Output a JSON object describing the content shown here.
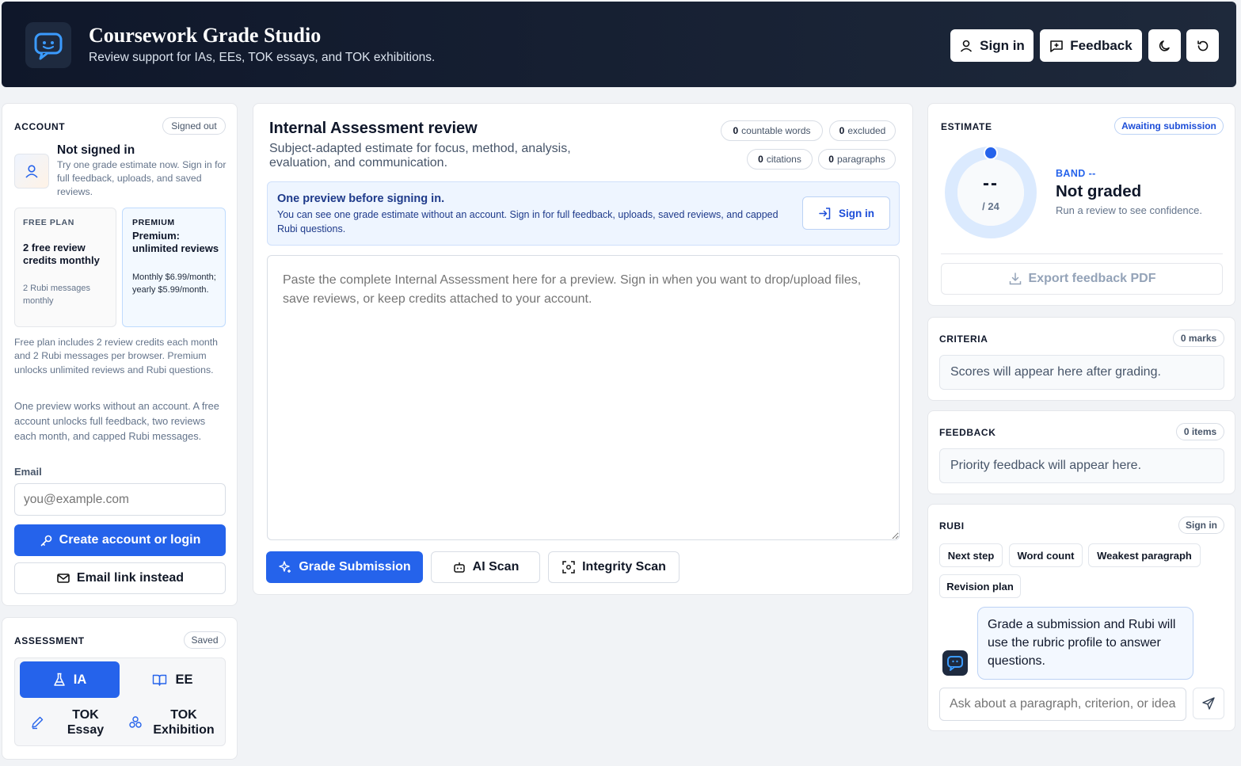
{
  "header": {
    "title": "Coursework Grade Studio",
    "subtitle": "Review support for IAs, EEs, TOK essays, and TOK exhibitions.",
    "sign_in_label": "Sign in",
    "feedback_label": "Feedback"
  },
  "account": {
    "section_label": "ACCOUNT",
    "status_badge": "Signed out",
    "title": "Not signed in",
    "description": "Try one grade estimate now. Sign in for full feedback, uploads, and saved reviews.",
    "free_plan": {
      "label": "FREE PLAN",
      "title": "2 free review credits monthly",
      "detail": "2 Rubi messages monthly"
    },
    "premium_plan": {
      "label": "PREMIUM",
      "title": "Premium: unlimited reviews",
      "detail": "Monthly $6.99/month; yearly $5.99/month."
    },
    "plan_note": "Free plan includes 2 review credits each month and 2 Rubi messages per browser. Premium unlocks unlimited reviews and Rubi questions.",
    "preview_note": "One preview works without an account. A free account unlocks full feedback, two reviews each month, and capped Rubi messages.",
    "email_label": "Email",
    "email_placeholder": "you@example.com",
    "create_account_label": "Create account or login",
    "email_link_label": "Email link instead"
  },
  "assessment": {
    "section_label": "ASSESSMENT",
    "status_badge": "Saved",
    "types": [
      "IA",
      "EE",
      "TOK Essay",
      "TOK Exhibition"
    ],
    "selected": "IA"
  },
  "review": {
    "title": "Internal Assessment review",
    "subtitle": "Subject-adapted estimate for focus, method, analysis, evaluation, and communication.",
    "stats": {
      "countable_words": "0",
      "countable_words_label": "countable words",
      "excluded": "0",
      "excluded_label": "excluded",
      "citations": "0",
      "citations_label": "citations",
      "paragraphs": "0",
      "paragraphs_label": "paragraphs"
    },
    "preview_notice": {
      "title": "One preview before signing in.",
      "body": "You can see one grade estimate without an account. Sign in for full feedback, uploads, saved reviews, and capped Rubi questions.",
      "button_label": "Sign in"
    },
    "textarea_placeholder": "Paste the complete Internal Assessment here for a preview. Sign in when you want to drop/upload files, save reviews, or keep credits attached to your account.",
    "grade_button": "Grade Submission",
    "ai_scan_button": "AI Scan",
    "integrity_scan_button": "Integrity Scan"
  },
  "estimate": {
    "section_label": "ESTIMATE",
    "status_badge": "Awaiting submission",
    "score": "--",
    "max": "/ 24",
    "band": "BAND --",
    "title": "Not graded",
    "subtitle": "Run a review to see confidence.",
    "export_label": "Export feedback PDF",
    "progress": 0
  },
  "criteria": {
    "section_label": "CRITERIA",
    "badge": "0 marks",
    "placeholder": "Scores will appear here after grading."
  },
  "feedback": {
    "section_label": "FEEDBACK",
    "badge": "0 items",
    "placeholder": "Priority feedback will appear here."
  },
  "rubi": {
    "section_label": "RUBI",
    "badge": "Sign in",
    "chips": [
      "Next step",
      "Word count",
      "Weakest paragraph",
      "Revision plan"
    ],
    "message": "Grade a submission and Rubi will use the rubric profile to answer questions.",
    "input_placeholder": "Ask about a paragraph, criterion, or idea"
  },
  "colors": {
    "accent": "#2563eb",
    "header_bg": "#0f172a",
    "notice_bg": "#eef5ff"
  }
}
